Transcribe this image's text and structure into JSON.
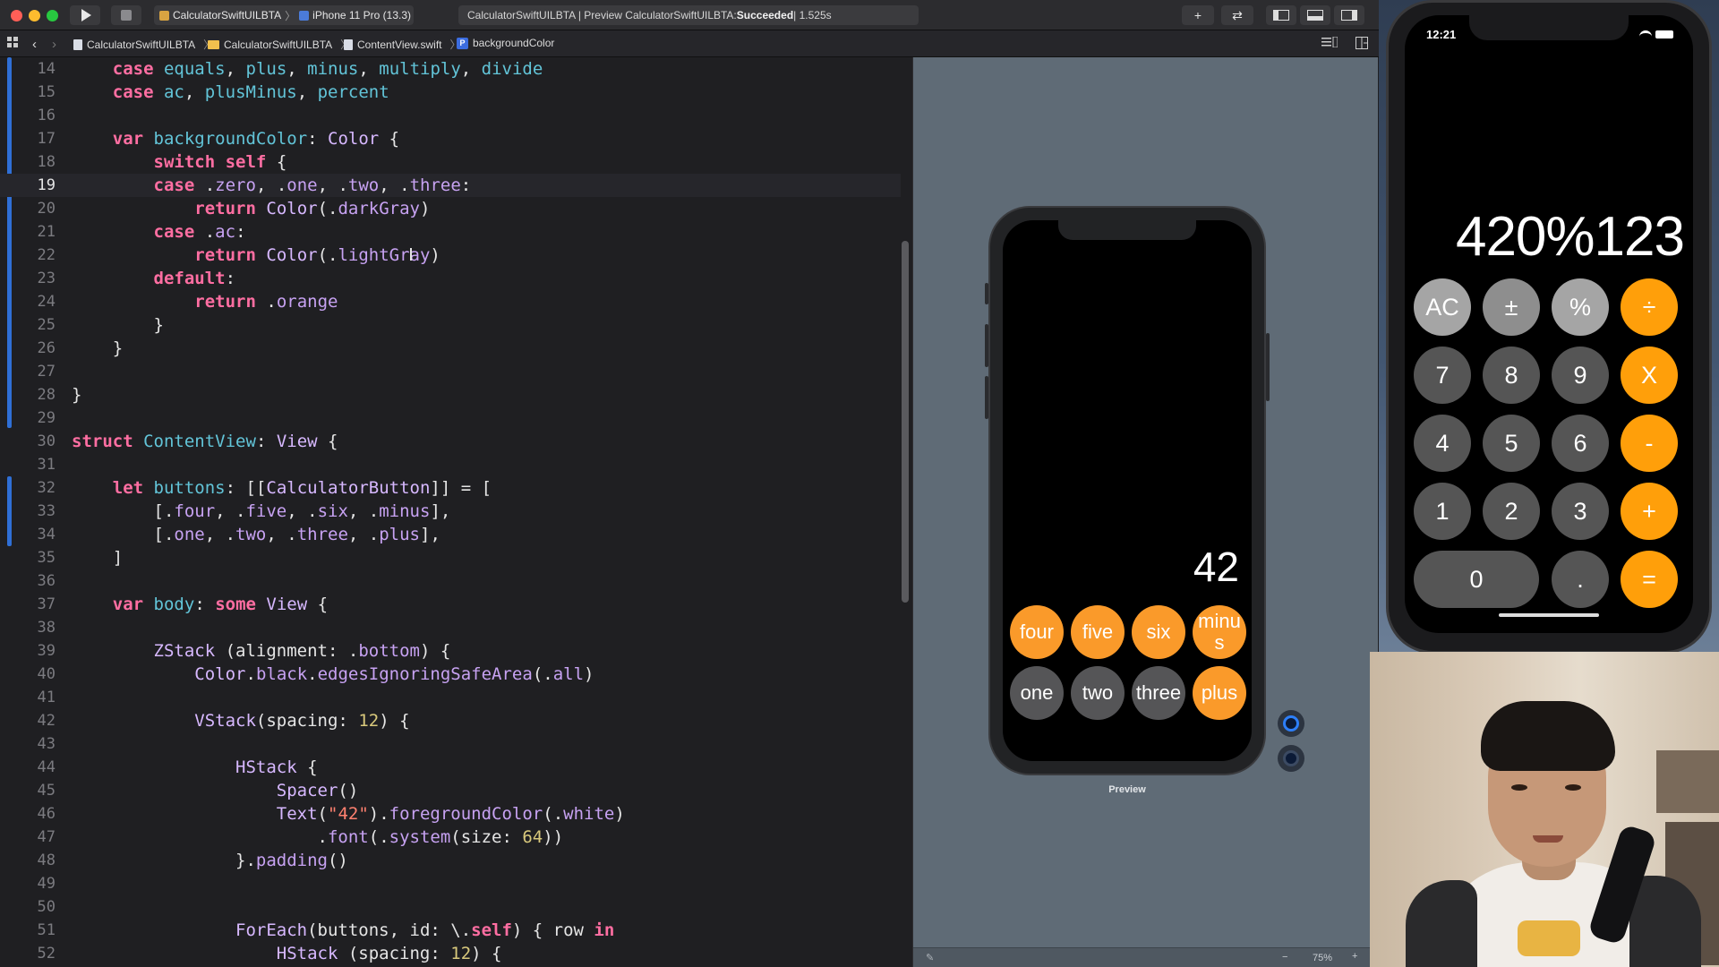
{
  "toolbar": {
    "scheme_target": "CalculatorSwiftUILBTA",
    "scheme_sep": "〉",
    "scheme_device": "iPhone 11 Pro (13.3)",
    "status_prefix": "CalculatorSwiftUILBTA | Preview CalculatorSwiftUILBTA: ",
    "status_result": "Succeeded",
    "status_suffix": " | 1.525s",
    "add_label": "+",
    "swap_label": "⇄"
  },
  "breadcrumbs": [
    "CalculatorSwiftUILBTA",
    "CalculatorSwiftUILBTA",
    "ContentView.swift",
    "backgroundColor"
  ],
  "editor": {
    "line_numbers": [
      "14",
      "15",
      "16",
      "17",
      "18",
      "19",
      "20",
      "21",
      "22",
      "23",
      "24",
      "25",
      "26",
      "27",
      "28",
      "29",
      "30",
      "31",
      "32",
      "33",
      "34",
      "35",
      "36",
      "37",
      "38",
      "39",
      "40",
      "41",
      "42",
      "43",
      "44",
      "45",
      "46",
      "47",
      "48",
      "49",
      "50",
      "51",
      "52"
    ]
  },
  "canvas": {
    "display": "42",
    "preview_label": "Preview",
    "zoom": "75%",
    "zoom_minus": "−",
    "zoom_plus": "+",
    "rows": [
      [
        "four",
        "five",
        "six",
        "minus"
      ],
      [
        "one",
        "two",
        "three",
        "plus"
      ]
    ]
  },
  "simulator": {
    "time": "12:21",
    "display": "420%123",
    "keys": {
      "ac": "AC",
      "plus_minus": "±",
      "percent": "%",
      "divide": "÷",
      "seven": "7",
      "eight": "8",
      "nine": "9",
      "multiply": "X",
      "four": "4",
      "five": "5",
      "six": "6",
      "minus": "-",
      "one": "1",
      "two": "2",
      "three": "3",
      "plus": "+",
      "zero": "0",
      "decimal": ".",
      "equals": "="
    }
  },
  "colors": {
    "accent_orange": "#ff9f0a",
    "key_light": "#a5a5a5",
    "key_dark": "#333333",
    "keyword_pink": "#ff6ea2",
    "change_bar_blue": "#2f6fd6"
  }
}
